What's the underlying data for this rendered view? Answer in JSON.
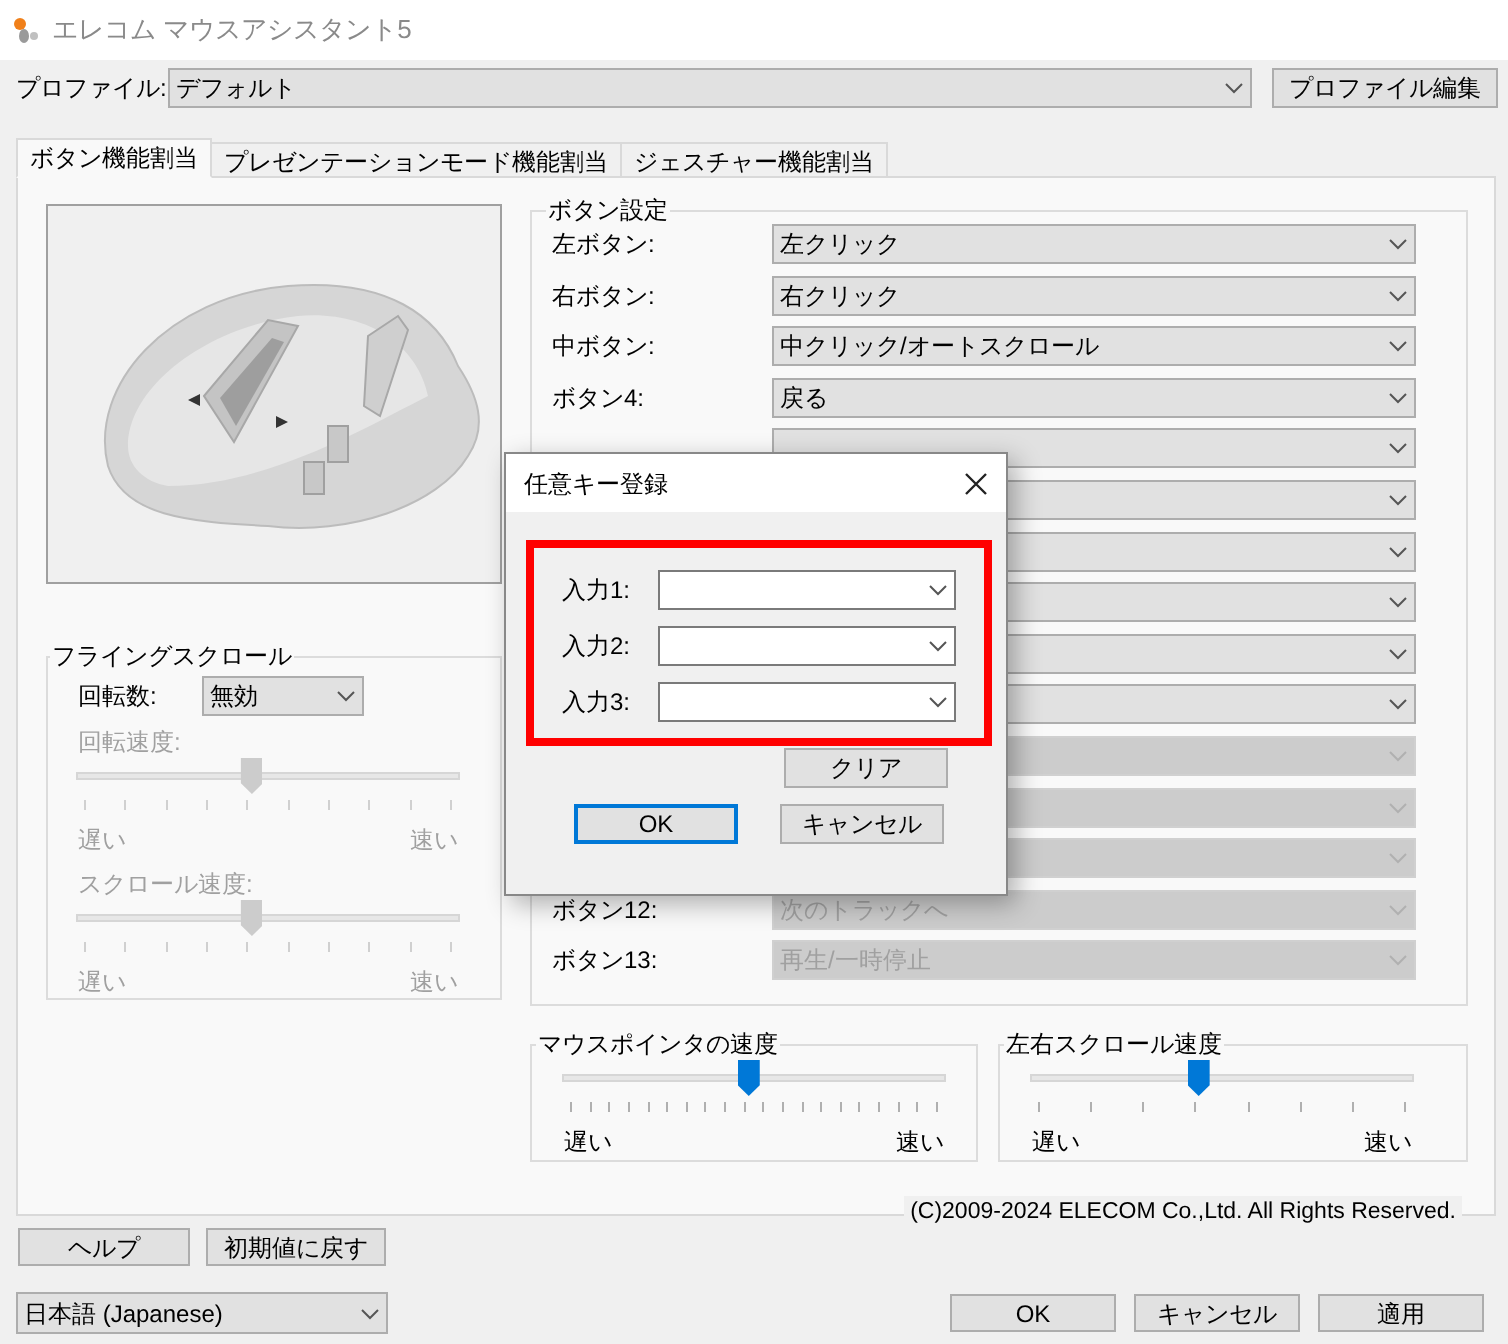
{
  "window": {
    "title": "エレコム マウスアシスタント5"
  },
  "profile": {
    "label": "プロファイル:",
    "value": "デフォルト",
    "edit_button": "プロファイル編集"
  },
  "tabs": [
    {
      "label": "ボタン機能割当",
      "selected": true
    },
    {
      "label": "プレゼンテーションモード機能割当",
      "selected": false
    },
    {
      "label": "ジェスチャー機能割当",
      "selected": false
    }
  ],
  "mouse_image": {
    "kind": "picture"
  },
  "flying_scroll": {
    "title": "フライングスクロール",
    "rotation": {
      "label": "回転数:",
      "value": "無効"
    },
    "sliders": [
      {
        "label": "回転速度:",
        "level": 0.45,
        "disabled": true,
        "min_label": "遅い",
        "max_label": "速い"
      },
      {
        "label": "スクロール速度:",
        "level": 0.45,
        "disabled": true,
        "min_label": "遅い",
        "max_label": "速い"
      }
    ]
  },
  "button_settings": {
    "title": "ボタン設定",
    "rows": [
      {
        "label": "左ボタン:",
        "value": "左クリック",
        "disabled": false
      },
      {
        "label": "右ボタン:",
        "value": "右クリック",
        "disabled": false
      },
      {
        "label": "中ボタン:",
        "value": "中クリック/オートスクロール",
        "disabled": false
      },
      {
        "label": "ボタン4:",
        "value": "戻る",
        "disabled": false
      },
      {
        "disabled": false
      },
      {
        "disabled": false
      },
      {
        "disabled": false
      },
      {
        "disabled": false
      },
      {
        "disabled": false
      },
      {
        "disabled": false
      },
      {
        "disabled": true
      },
      {
        "disabled": true
      },
      {
        "disabled": true
      },
      {
        "label": "ボタン12:",
        "value": "次のトラックへ",
        "disabled": true
      },
      {
        "label": "ボタン13:",
        "value": "再生/一時停止",
        "disabled": true
      }
    ]
  },
  "speed_groups": [
    {
      "title": "マウスポインタの速度",
      "level": 0.48,
      "min_label": "遅い",
      "max_label": "速い"
    },
    {
      "title": "左右スクロール速度",
      "level": 0.43,
      "min_label": "遅い",
      "max_label": "速い"
    }
  ],
  "copyright": "(C)2009-2024 ELECOM Co.,Ltd. All Rights Reserved.",
  "footer_buttons": [
    "ヘルプ",
    "初期値に戻す"
  ],
  "language": "日本語 (Japanese)",
  "dialog_buttons": [
    "OK",
    "キャンセル",
    "適用"
  ],
  "key_dialog": {
    "title": "任意キー登録",
    "highlighted": true,
    "inputs": [
      {
        "label": "入力1:"
      },
      {
        "label": "入力2:"
      },
      {
        "label": "入力3:"
      }
    ],
    "clear_button": "クリア",
    "buttons": [
      {
        "label": "OK",
        "focused": true
      },
      {
        "label": "キャンセル",
        "focused": false
      }
    ]
  }
}
